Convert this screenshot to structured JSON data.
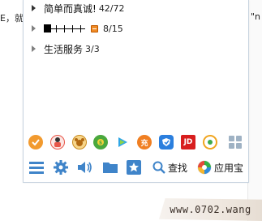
{
  "background": {
    "left_text": "E，就",
    "right_text": "\"n"
  },
  "groups": [
    {
      "name": "简单而真诚!",
      "count": "42/72",
      "expanded": false
    },
    {
      "name": "",
      "count": "8/15",
      "expanded": false,
      "name_masked": true,
      "has_vip_badge": true
    },
    {
      "name": "生活服务",
      "count": "3/3",
      "expanded": false
    }
  ],
  "apps": [
    {
      "icon": "qq-tasks-icon",
      "color": "#f29a2e"
    },
    {
      "icon": "qq-show-icon",
      "color": "#e8574a"
    },
    {
      "icon": "qq-pet-icon",
      "color": "#f3b33a"
    },
    {
      "icon": "qq-wallet-icon",
      "color": "#4aa83d"
    },
    {
      "icon": "tencent-video-icon",
      "color": "#2fa6e6"
    },
    {
      "icon": "recharge-icon",
      "color": "#f07f22",
      "text": "充"
    },
    {
      "icon": "qq-security-icon",
      "color": "#2b7fde"
    },
    {
      "icon": "jd-icon",
      "color": "#d81e1e",
      "text": "JD"
    },
    {
      "icon": "qq-music-icon",
      "color": "#f0a51f"
    },
    {
      "icon": "app-grid-icon",
      "color": "#9fb2c4"
    }
  ],
  "toolbar": {
    "menu_icon": "hamburger-menu-icon",
    "settings_icon": "gear-icon",
    "sound_icon": "speaker-icon",
    "folder_icon": "folder-icon",
    "favorites_icon": "star-box-icon",
    "search_label": "查找",
    "app_store_label": "应用宝",
    "accent_color": "#3f84c9"
  },
  "watermark": "www.0702.wang"
}
